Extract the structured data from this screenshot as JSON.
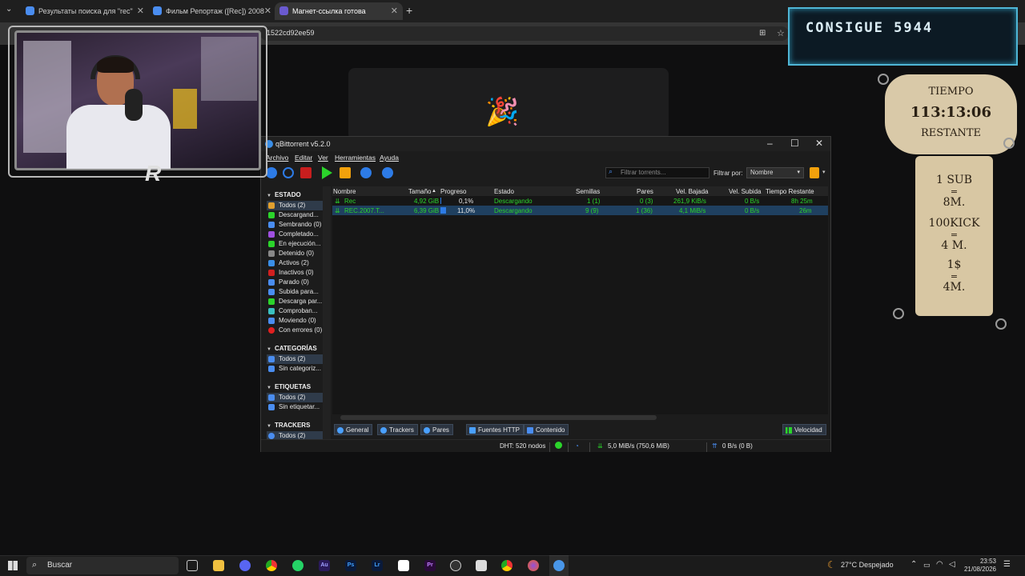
{
  "browser": {
    "tabs": [
      {
        "label": "Результаты поиска для \"rec\"",
        "fav_color": "#4a8df0"
      },
      {
        "label": "Фильм Репортаж ([Rec]) 2008",
        "fav_color": "#4a8df0"
      },
      {
        "label": "Магнет-ссылка готова",
        "fav_color": "#6a5ad0"
      }
    ],
    "new_tab": "+",
    "url": "1522cd92ee59"
  },
  "qbt": {
    "title": "qBittorrent v5.2.0",
    "menu": [
      "Archivo",
      "Editar",
      "Ver",
      "Herramientas",
      "Ayuda"
    ],
    "filter_placeholder": "Filtrar torrents...",
    "filter_label": "Filtrar por:",
    "filter_value": "Nombre",
    "sidebar": {
      "estado_header": "ESTADO",
      "estado": [
        {
          "label": "Todos (2)",
          "icon": "all-icon",
          "color": "#e0a030"
        },
        {
          "label": "Descargand...",
          "icon": "download-icon",
          "color": "#2bd42b"
        },
        {
          "label": "Sembrando (0)",
          "icon": "upload-icon",
          "color": "#4a8df0"
        },
        {
          "label": "Completado...",
          "icon": "check-icon",
          "color": "#a050e0"
        },
        {
          "label": "En ejecución...",
          "icon": "play-icon",
          "color": "#2bd42b"
        },
        {
          "label": "Detenido (0)",
          "icon": "stop-icon",
          "color": "#888888"
        },
        {
          "label": "Activos (2)",
          "icon": "active-icon",
          "color": "#3a8ee6"
        },
        {
          "label": "Inactivos (0)",
          "icon": "inactive-icon",
          "color": "#d02020"
        },
        {
          "label": "Parado (0)",
          "icon": "stalled-icon",
          "color": "#4a8df0"
        },
        {
          "label": "Subida para...",
          "icon": "stalled-up-icon",
          "color": "#4a8df0"
        },
        {
          "label": "Descarga par...",
          "icon": "stalled-down-icon",
          "color": "#2bd42b"
        },
        {
          "label": "Comproban...",
          "icon": "checking-icon",
          "color": "#3ac0c0"
        },
        {
          "label": "Moviendo (0)",
          "icon": "moving-icon",
          "color": "#4a8df0"
        },
        {
          "label": "Con errores (0)",
          "icon": "error-icon",
          "color": "#e02020"
        }
      ],
      "categorias_header": "CATEGORÍAS",
      "categorias": [
        "Todos (2)",
        "Sin categoriz..."
      ],
      "etiquetas_header": "ETIQUETAS",
      "etiquetas": [
        "Todos (2)",
        "Sin etiquetar..."
      ],
      "trackers_header": "TRACKERS",
      "trackers": [
        "Todos (2)"
      ]
    },
    "columns": [
      "Nombre",
      "Tamaño",
      "Progreso",
      "Estado",
      "Semillas",
      "Pares",
      "Vel. Bajada",
      "Vel. Subida",
      "Tiempo Restante"
    ],
    "rows": [
      {
        "name": "Rec",
        "size": "4,92 GiB",
        "progress": "0,1%",
        "progress_value": 0.001,
        "status": "Descargando",
        "seeds": "1 (1)",
        "peers": "0 (3)",
        "down": "261,9 KiB/s",
        "up": "0 B/s",
        "eta": "8h 25m"
      },
      {
        "name": "REC.2007.T...",
        "size": "6,39 GiB",
        "progress": "11,0%",
        "progress_value": 0.11,
        "status": "Descargando",
        "seeds": "9 (9)",
        "peers": "1 (36)",
        "down": "4,1 MiB/s",
        "up": "0 B/s",
        "eta": "26m"
      }
    ],
    "bottom_tabs": [
      "General",
      "Trackers",
      "Pares",
      "Fuentes HTTP",
      "Contenido"
    ],
    "speed_btn": "Velocidad",
    "status": {
      "dht": "DHT: 520 nodos",
      "down": "5,0 MiB/s (750,6 MiB)",
      "up": "0 B/s (0 B)"
    }
  },
  "overlay": {
    "goal": "CONSIGUE 5944",
    "timer_title": "TIEMPO",
    "timer": "113:13:06",
    "timer_sub": "RESTANTE",
    "rules": [
      "1 SUB",
      "=",
      "8M.",
      "100KICK",
      "=",
      "4 M.",
      "1$",
      "=",
      "4M."
    ]
  },
  "taskbar": {
    "search": "Buscar",
    "weather": "27°C Despejado",
    "time": "23:53",
    "date": "21/08/2026",
    "apps": [
      {
        "label": "Au",
        "color": "#2a1a5a",
        "fg": "#a0a0ff"
      },
      {
        "label": "Ps",
        "color": "#0a1a3a",
        "fg": "#40a0ff"
      },
      {
        "label": "Lr",
        "color": "#0a1a3a",
        "fg": "#40a0ff"
      },
      {
        "label": "Pr",
        "color": "#2a0a3a",
        "fg": "#c080ff"
      }
    ]
  }
}
